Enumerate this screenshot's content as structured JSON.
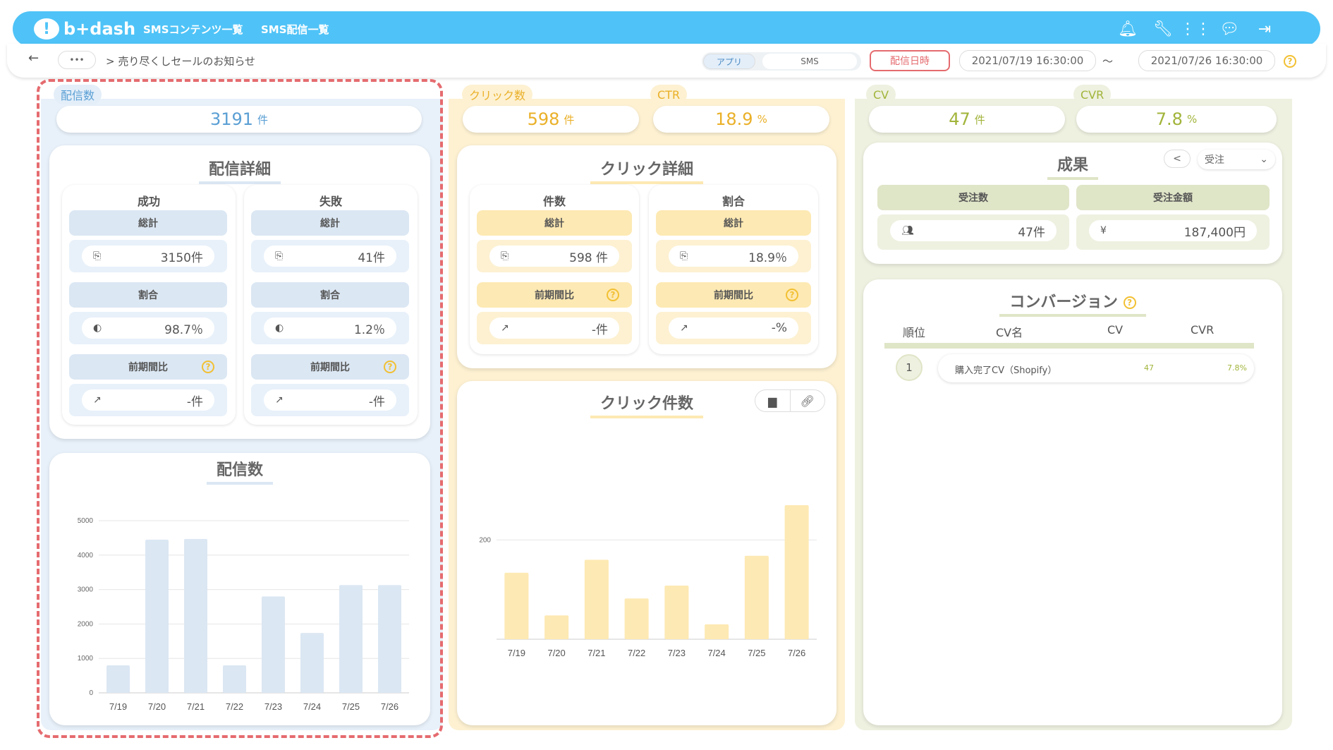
{
  "header": {
    "logo": "b+dash",
    "nav": [
      "SMSコンテンツ一覧",
      "SMS配信一覧"
    ],
    "icons": [
      "bell-icon",
      "wrench-icon",
      "grid-icon",
      "chat-icon",
      "logout-icon"
    ]
  },
  "subbar": {
    "back": "←",
    "more": "•••",
    "breadcrumb": "> 売り尽くしセールのお知らせ",
    "tab_app": "アプリ",
    "tab_sms": "SMS",
    "date_label": "配信日時",
    "date_from": "2021/07/19 16:30:00",
    "tilde": "〜",
    "date_to": "2021/07/26 16:30:00",
    "help": "?"
  },
  "delivery": {
    "badge": "配信数",
    "total": "3191",
    "unit": "件",
    "detail_title": "配信詳細",
    "chart_title": "配信数",
    "success": {
      "title": "成功",
      "total_label": "総計",
      "total": "3150件",
      "ratio_label": "割合",
      "ratio": "98.7％",
      "prev_label": "前期間比",
      "prev": "-件"
    },
    "failure": {
      "title": "失敗",
      "total_label": "総計",
      "total": "41件",
      "ratio_label": "割合",
      "ratio": "1.2％",
      "prev_label": "前期間比",
      "prev": "-件"
    }
  },
  "click": {
    "badge": "クリック数",
    "total": "598",
    "unit": "件",
    "ctr_badge": "CTR",
    "ctr": "18.9",
    "ctr_unit": "%",
    "detail_title": "クリック詳細",
    "chart_title": "クリック件数",
    "count": {
      "title": "件数",
      "total_label": "総計",
      "total": "598 件",
      "prev_label": "前期間比",
      "prev": "-件"
    },
    "ratio": {
      "title": "割合",
      "total_label": "総計",
      "total": "18.9％",
      "prev_label": "前期間比",
      "prev": "-%"
    }
  },
  "conversion": {
    "cv_badge": "CV",
    "cv": "47",
    "cv_unit": "件",
    "cvr_badge": "CVR",
    "cvr": "7.8",
    "cvr_unit": "%",
    "result_title": "成果",
    "select": "受注",
    "orders_label": "受注数",
    "orders": "47件",
    "amount_label": "受注金額",
    "amount": "187,400円",
    "conv_title": "コンバージョン",
    "cols": [
      "順位",
      "CV名",
      "CV",
      "CVR"
    ],
    "rows": [
      {
        "rank": "1",
        "name": "購入完了CV（Shopify）",
        "cv": "47",
        "cvr": "7.8%"
      }
    ]
  },
  "colors": {
    "blue": "#4fc3f7",
    "lightblue": "#e3eef9",
    "yellow": "#fde9b3",
    "lightyellow": "#fdf1d2",
    "green": "#dfe5c7",
    "lightgreen": "#eef1e0",
    "red": "#e56b6f"
  },
  "chart_data": [
    {
      "type": "bar",
      "title": "配信数",
      "categories": [
        "7/19",
        "7/20",
        "7/21",
        "7/22",
        "7/23",
        "7/24",
        "7/25",
        "7/26"
      ],
      "values": [
        800,
        4450,
        4470,
        800,
        2800,
        1740,
        3130,
        3130
      ],
      "ylim": [
        0,
        5000
      ],
      "yticks": [
        "0",
        "1000",
        "2000",
        "3000",
        "4000",
        "5000"
      ]
    },
    {
      "type": "bar",
      "title": "クリック件数",
      "categories": [
        "7/19",
        "7/20",
        "7/21",
        "7/22",
        "7/23",
        "7/24",
        "7/25",
        "7/26"
      ],
      "values": [
        134,
        48,
        160,
        82,
        108,
        30,
        168,
        270
      ],
      "ylim": [
        0,
        270
      ],
      "yticks": [
        "200"
      ]
    }
  ]
}
